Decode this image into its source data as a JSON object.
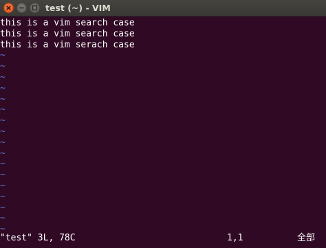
{
  "window": {
    "title": "test (~) - VIM",
    "controls": {
      "close_icon": "close-icon",
      "minimize_icon": "minimize-icon",
      "maximize_icon": "maximize-icon"
    },
    "colors": {
      "background": "#300a24",
      "text": "#ffffff",
      "tilde": "#5a6fd0",
      "close_button": "#e95420"
    }
  },
  "buffer": {
    "lines": [
      "this is a vim search case",
      "this is a vim search case",
      "this is a vim serach case"
    ],
    "empty_line_marker": "~"
  },
  "status": {
    "file_info": "\"test\" 3L, 78C",
    "cursor_position": "1,1",
    "scroll_position": "全部"
  }
}
